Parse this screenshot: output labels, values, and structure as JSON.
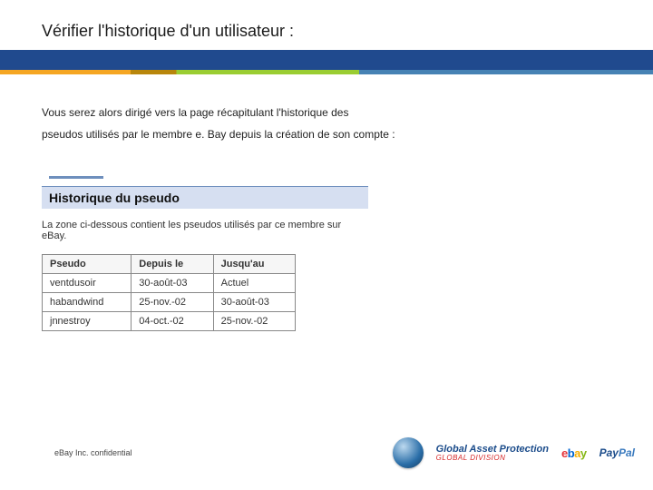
{
  "title": "Vérifier l'historique d'un utilisateur :",
  "intro_line1": "Vous serez alors dirigé vers la page récapitulant l'historique des",
  "intro_line2": "pseudos utilisés par le membre e. Bay depuis la création de son compte :",
  "panel": {
    "heading": "Historique du pseudo",
    "desc": "La zone ci-dessous contient les pseudos utilisés par ce membre sur eBay.",
    "columns": {
      "c1": "Pseudo",
      "c2": "Depuis le",
      "c3": "Jusqu'au"
    },
    "rows": [
      {
        "pseudo": "ventdusoir",
        "from": "30-août-03",
        "to": "Actuel"
      },
      {
        "pseudo": "habandwind",
        "from": "25-nov.-02",
        "to": "30-août-03"
      },
      {
        "pseudo": "jnnestroy",
        "from": "04-oct.-02",
        "to": "25-nov.-02"
      }
    ]
  },
  "footer": {
    "confidential": "eBay Inc. confidential",
    "gap_top": "Global Asset Protection",
    "gap_bot": "GLOBAL DIVISION"
  }
}
